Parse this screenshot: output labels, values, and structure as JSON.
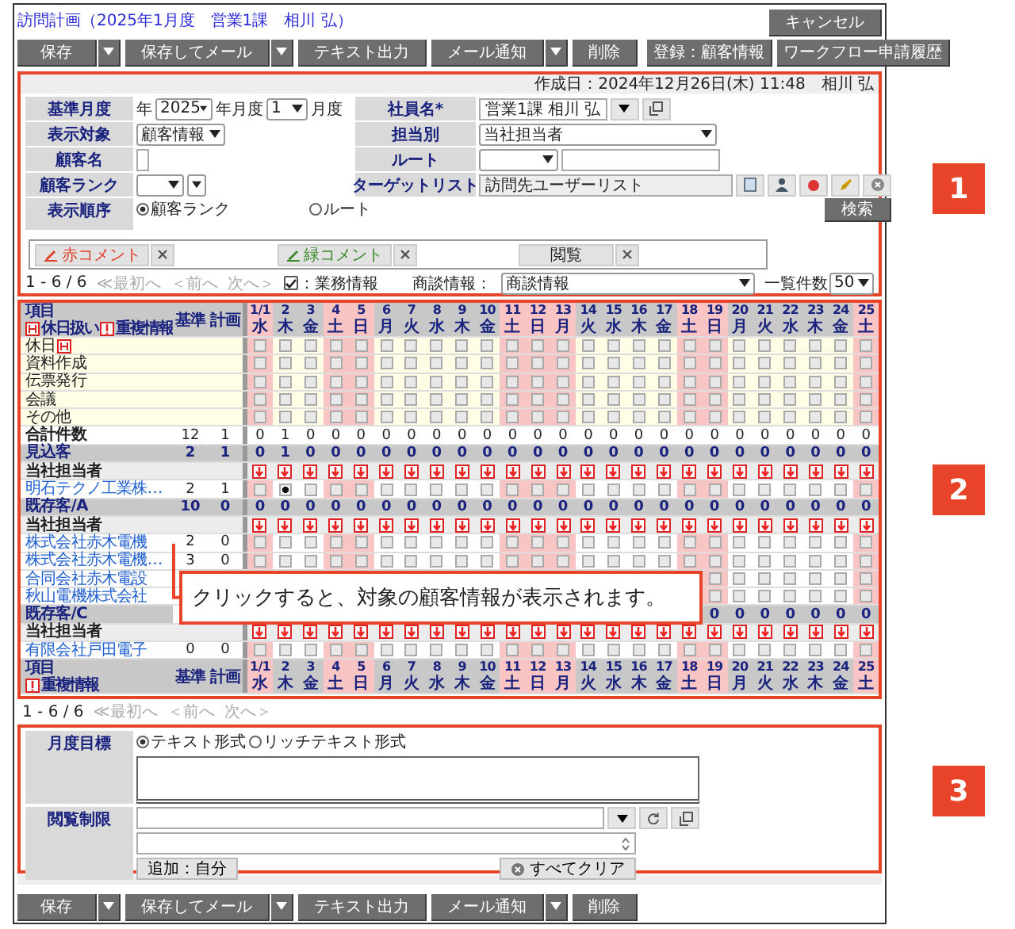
{
  "title": "訪問計画（2025年1月度　営業1課　相川 弘）",
  "cancel": "キャンセル",
  "toolbar": [
    {
      "label": "保存",
      "menu": true
    },
    {
      "label": "保存してメール",
      "menu": true
    },
    {
      "label": "テキスト出力",
      "menu": false
    },
    {
      "label": "メール通知",
      "menu": true
    },
    {
      "label": "削除",
      "menu": false
    }
  ],
  "toolbar_right": [
    "登録：顧客情報",
    "ワークフロー申請履歴"
  ],
  "form": {
    "created": "作成日：2024年12月26日(木) 11:48　相川 弘",
    "left": [
      {
        "kind": "month",
        "label": "基準月度",
        "year_prefix": "年",
        "year": "2025",
        "month_prefix": "年月度",
        "month": "1",
        "suffix": "月度"
      },
      {
        "kind": "select",
        "label": "表示対象",
        "value": "顧客情報"
      },
      {
        "kind": "text",
        "label": "顧客名"
      },
      {
        "kind": "rank",
        "label": "顧客ランク"
      },
      {
        "kind": "radio",
        "label": "表示順序",
        "options": [
          {
            "label": "顧客ランク",
            "selected": true
          },
          {
            "label": "ルート",
            "selected": false
          }
        ]
      }
    ],
    "right": [
      {
        "kind": "picker",
        "label": "社員名*",
        "value": "営業1課 相川 弘"
      },
      {
        "kind": "select",
        "label": "担当別",
        "value": "当社担当者"
      },
      {
        "kind": "route",
        "label": "ルート"
      },
      {
        "kind": "target",
        "label": "ターゲットリスト",
        "value": "訪問先ユーザーリスト"
      },
      {
        "kind": "search",
        "button": "検索"
      }
    ]
  },
  "comments": [
    {
      "kind": "pen",
      "label": "赤コメント",
      "color": "#e0402a"
    },
    {
      "kind": "pen",
      "label": "緑コメント",
      "color": "#3a8a2a"
    },
    {
      "kind": "plain",
      "label": "閲覧"
    }
  ],
  "pager": {
    "range": "1 - 6 / 6",
    "first": "≪最初へ",
    "prev": "＜前へ",
    "next": "次へ＞",
    "filter_checked": true,
    "filter_label": "：業務情報",
    "deal_label": "商談情報：",
    "deal_value": "商談情報",
    "count_label": "一覧件数",
    "count_value": "50"
  },
  "grid": {
    "header": {
      "item": "項目",
      "notes": [
        {
          "kind": "holiday",
          "text": "休日扱い"
        },
        {
          "kind": "duplicate",
          "text": "重複情報"
        }
      ],
      "base": "基準",
      "plan": "計画",
      "days": [
        {
          "date": "1/1",
          "weekday": "水",
          "holiday": true
        },
        {
          "date": "2",
          "weekday": "木",
          "holiday": false
        },
        {
          "date": "3",
          "weekday": "金",
          "holiday": false
        },
        {
          "date": "4",
          "weekday": "土",
          "holiday": true
        },
        {
          "date": "5",
          "weekday": "日",
          "holiday": true
        },
        {
          "date": "6",
          "weekday": "月",
          "holiday": false
        },
        {
          "date": "7",
          "weekday": "火",
          "holiday": false
        },
        {
          "date": "8",
          "weekday": "水",
          "holiday": false
        },
        {
          "date": "9",
          "weekday": "木",
          "holiday": false
        },
        {
          "date": "10",
          "weekday": "金",
          "holiday": false
        },
        {
          "date": "11",
          "weekday": "土",
          "holiday": true
        },
        {
          "date": "12",
          "weekday": "日",
          "holiday": true
        },
        {
          "date": "13",
          "weekday": "月",
          "holiday": true
        },
        {
          "date": "14",
          "weekday": "火",
          "holiday": false
        },
        {
          "date": "15",
          "weekday": "水",
          "holiday": false
        },
        {
          "date": "16",
          "weekday": "木",
          "holiday": false
        },
        {
          "date": "17",
          "weekday": "金",
          "holiday": false
        },
        {
          "date": "18",
          "weekday": "土",
          "holiday": true
        },
        {
          "date": "19",
          "weekday": "日",
          "holiday": true
        },
        {
          "date": "20",
          "weekday": "月",
          "holiday": false
        },
        {
          "date": "21",
          "weekday": "火",
          "holiday": false
        },
        {
          "date": "22",
          "weekday": "水",
          "holiday": false
        },
        {
          "date": "23",
          "weekday": "木",
          "holiday": false
        },
        {
          "date": "24",
          "weekday": "金",
          "holiday": false
        },
        {
          "date": "25",
          "weekday": "土",
          "holiday": true
        }
      ]
    },
    "rows": [
      {
        "kind": "task",
        "label": "休日",
        "holiday_icon": true,
        "boxes": [
          false,
          false,
          false,
          false,
          false,
          false,
          false,
          false,
          false,
          false,
          false,
          false,
          false,
          false,
          false,
          false,
          false,
          false,
          false,
          false,
          false,
          false,
          false,
          false,
          false
        ]
      },
      {
        "kind": "task",
        "label": "資料作成",
        "holiday_icon": false,
        "boxes": [
          false,
          false,
          false,
          false,
          false,
          false,
          false,
          false,
          false,
          false,
          false,
          false,
          false,
          false,
          false,
          false,
          false,
          false,
          false,
          false,
          false,
          false,
          false,
          false,
          false
        ]
      },
      {
        "kind": "task",
        "label": "伝票発行",
        "holiday_icon": false,
        "boxes": [
          false,
          false,
          false,
          false,
          false,
          false,
          false,
          false,
          false,
          false,
          false,
          false,
          false,
          false,
          false,
          false,
          false,
          false,
          false,
          false,
          false,
          false,
          false,
          false,
          false
        ]
      },
      {
        "kind": "task",
        "label": "会議",
        "holiday_icon": false,
        "boxes": [
          false,
          false,
          false,
          false,
          false,
          false,
          false,
          false,
          false,
          false,
          false,
          false,
          false,
          false,
          false,
          false,
          false,
          false,
          false,
          false,
          false,
          false,
          false,
          false,
          false
        ]
      },
      {
        "kind": "task",
        "label": "その他",
        "holiday_icon": false,
        "boxes": [
          false,
          false,
          false,
          false,
          false,
          false,
          false,
          false,
          false,
          false,
          false,
          false,
          false,
          false,
          false,
          false,
          false,
          false,
          false,
          false,
          false,
          false,
          false,
          false,
          false
        ]
      },
      {
        "kind": "total",
        "label": "合計件数",
        "base": "12",
        "plan": "1",
        "values": [
          "0",
          "1",
          "0",
          "0",
          "0",
          "0",
          "0",
          "0",
          "0",
          "0",
          "0",
          "0",
          "0",
          "0",
          "0",
          "0",
          "0",
          "0",
          "0",
          "0",
          "0",
          "0",
          "0",
          "0",
          "0"
        ]
      },
      {
        "kind": "group",
        "label": "見込客",
        "base": "2",
        "plan": "1",
        "values": [
          "0",
          "1",
          "0",
          "0",
          "0",
          "0",
          "0",
          "0",
          "0",
          "0",
          "0",
          "0",
          "0",
          "0",
          "0",
          "0",
          "0",
          "0",
          "0",
          "0",
          "0",
          "0",
          "0",
          "0",
          "0"
        ]
      },
      {
        "kind": "owner",
        "label": "当社担当者"
      },
      {
        "kind": "customer",
        "label": "明石テクノ工業株…",
        "base": "2",
        "plan": "1",
        "boxes": [
          false,
          true,
          false,
          false,
          false,
          false,
          false,
          false,
          false,
          false,
          false,
          false,
          false,
          false,
          false,
          false,
          false,
          false,
          false,
          false,
          false,
          false,
          false,
          false,
          false
        ]
      },
      {
        "kind": "group",
        "label": "既存客/A",
        "base": "10",
        "plan": "0",
        "values": [
          "0",
          "0",
          "0",
          "0",
          "0",
          "0",
          "0",
          "0",
          "0",
          "0",
          "0",
          "0",
          "0",
          "0",
          "0",
          "0",
          "0",
          "0",
          "0",
          "0",
          "0",
          "0",
          "0",
          "0",
          "0"
        ]
      },
      {
        "kind": "owner",
        "label": "当社担当者"
      },
      {
        "kind": "customer",
        "label": "株式会社赤木電機",
        "base": "2",
        "plan": "0",
        "boxes": [
          false,
          false,
          false,
          false,
          false,
          false,
          false,
          false,
          false,
          false,
          false,
          false,
          false,
          false,
          false,
          false,
          false,
          false,
          false,
          false,
          false,
          false,
          false,
          false,
          false
        ]
      },
      {
        "kind": "customer",
        "label": "株式会社赤木電機…",
        "base": "3",
        "plan": "0",
        "boxes": [
          false,
          false,
          false,
          false,
          false,
          false,
          false,
          false,
          false,
          false,
          false,
          false,
          false,
          false,
          false,
          false,
          false,
          false,
          false,
          false,
          false,
          false,
          false,
          false,
          false
        ]
      },
      {
        "kind": "customer",
        "label": "合同会社赤木電設",
        "covered": true,
        "boxes": [
          false,
          false,
          false,
          false,
          false,
          false,
          false
        ]
      },
      {
        "kind": "customer",
        "label": "秋山電機株式会社",
        "covered": true,
        "boxes": [
          false,
          false,
          false,
          false,
          false,
          false,
          false
        ]
      },
      {
        "kind": "group",
        "label": "既存客/C",
        "covered": true,
        "values": [
          "0",
          "0",
          "0",
          "0",
          "0",
          "0",
          "0"
        ]
      },
      {
        "kind": "owner",
        "label": "当社担当者"
      },
      {
        "kind": "customer",
        "label": "有限会社戸田電子",
        "base": "0",
        "plan": "0",
        "boxes": [
          false,
          false,
          false,
          false,
          false,
          false,
          false,
          false,
          false,
          false,
          false,
          false,
          false,
          false,
          false,
          false,
          false,
          false,
          false,
          false,
          false,
          false,
          false,
          false,
          false
        ]
      }
    ],
    "footer": {
      "item": "項目",
      "notes": [
        {
          "kind": "duplicate",
          "text": "重複情報"
        }
      ],
      "base": "基準",
      "plan": "計画",
      "days": [
        {
          "date": "1/1",
          "weekday": "水",
          "holiday": true
        },
        {
          "date": "2",
          "weekday": "木",
          "holiday": false
        },
        {
          "date": "3",
          "weekday": "金",
          "holiday": false
        },
        {
          "date": "4",
          "weekday": "土",
          "holiday": true
        },
        {
          "date": "5",
          "weekday": "日",
          "holiday": true
        },
        {
          "date": "6",
          "weekday": "月",
          "holiday": false
        },
        {
          "date": "7",
          "weekday": "火",
          "holiday": false
        },
        {
          "date": "8",
          "weekday": "水",
          "holiday": false
        },
        {
          "date": "9",
          "weekday": "木",
          "holiday": false
        },
        {
          "date": "10",
          "weekday": "金",
          "holiday": false
        },
        {
          "date": "11",
          "weekday": "土",
          "holiday": true
        },
        {
          "date": "12",
          "weekday": "日",
          "holiday": true
        },
        {
          "date": "13",
          "weekday": "月",
          "holiday": true
        },
        {
          "date": "14",
          "weekday": "火",
          "holiday": false
        },
        {
          "date": "15",
          "weekday": "水",
          "holiday": false
        },
        {
          "date": "16",
          "weekday": "木",
          "holiday": false
        },
        {
          "date": "17",
          "weekday": "金",
          "holiday": false
        },
        {
          "date": "18",
          "weekday": "土",
          "holiday": true
        },
        {
          "date": "19",
          "weekday": "日",
          "holiday": true
        },
        {
          "date": "20",
          "weekday": "月",
          "holiday": false
        },
        {
          "date": "21",
          "weekday": "火",
          "holiday": false
        },
        {
          "date": "22",
          "weekday": "水",
          "holiday": false
        },
        {
          "date": "23",
          "weekday": "木",
          "holiday": false
        },
        {
          "date": "24",
          "weekday": "金",
          "holiday": false
        },
        {
          "date": "25",
          "weekday": "土",
          "holiday": true
        }
      ]
    }
  },
  "callout": "クリックすると、対象の顧客情報が表示されます。",
  "pager_bottom": {
    "range": "1 - 6 / 6",
    "first": "≪最初へ",
    "prev": "＜前へ",
    "next": "次へ＞"
  },
  "goal": {
    "label": "月度目標",
    "formats": [
      {
        "label": "テキスト形式",
        "selected": true
      },
      {
        "label": "リッチテキスト形式",
        "selected": false
      }
    ]
  },
  "restriction": {
    "label": "閲覧制限",
    "add_self": "追加：自分",
    "clear_all": "すべてクリア"
  },
  "bottom_toolbar": [
    {
      "label": "保存",
      "menu": true
    },
    {
      "label": "保存してメール",
      "menu": true
    },
    {
      "label": "テキスト出力",
      "menu": false
    },
    {
      "label": "メール通知",
      "menu": true
    },
    {
      "label": "削除",
      "menu": false
    }
  ],
  "badges": [
    "1",
    "2",
    "3"
  ]
}
